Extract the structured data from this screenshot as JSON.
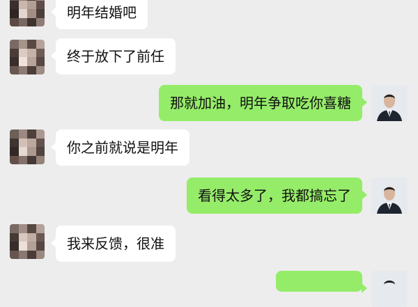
{
  "colors": {
    "background": "#ededed",
    "incoming_bubble": "#ffffff",
    "outgoing_bubble": "#95ec69"
  },
  "messages": [
    {
      "direction": "incoming",
      "text": "明年结婚吧",
      "avatar": "pixelated-contact-avatar"
    },
    {
      "direction": "incoming",
      "text": "终于放下了前任",
      "avatar": "pixelated-contact-avatar"
    },
    {
      "direction": "outgoing",
      "text": "那就加油，明年争取吃你喜糖",
      "avatar": "man-in-suit-avatar"
    },
    {
      "direction": "incoming",
      "text": "你之前就说是明年",
      "avatar": "pixelated-contact-avatar"
    },
    {
      "direction": "outgoing",
      "text": "看得太多了，我都搞忘了",
      "avatar": "man-in-suit-avatar"
    },
    {
      "direction": "incoming",
      "text": "我来反馈，很准",
      "avatar": "pixelated-contact-avatar"
    },
    {
      "direction": "outgoing",
      "text": "",
      "avatar": "man-in-suit-avatar"
    }
  ]
}
